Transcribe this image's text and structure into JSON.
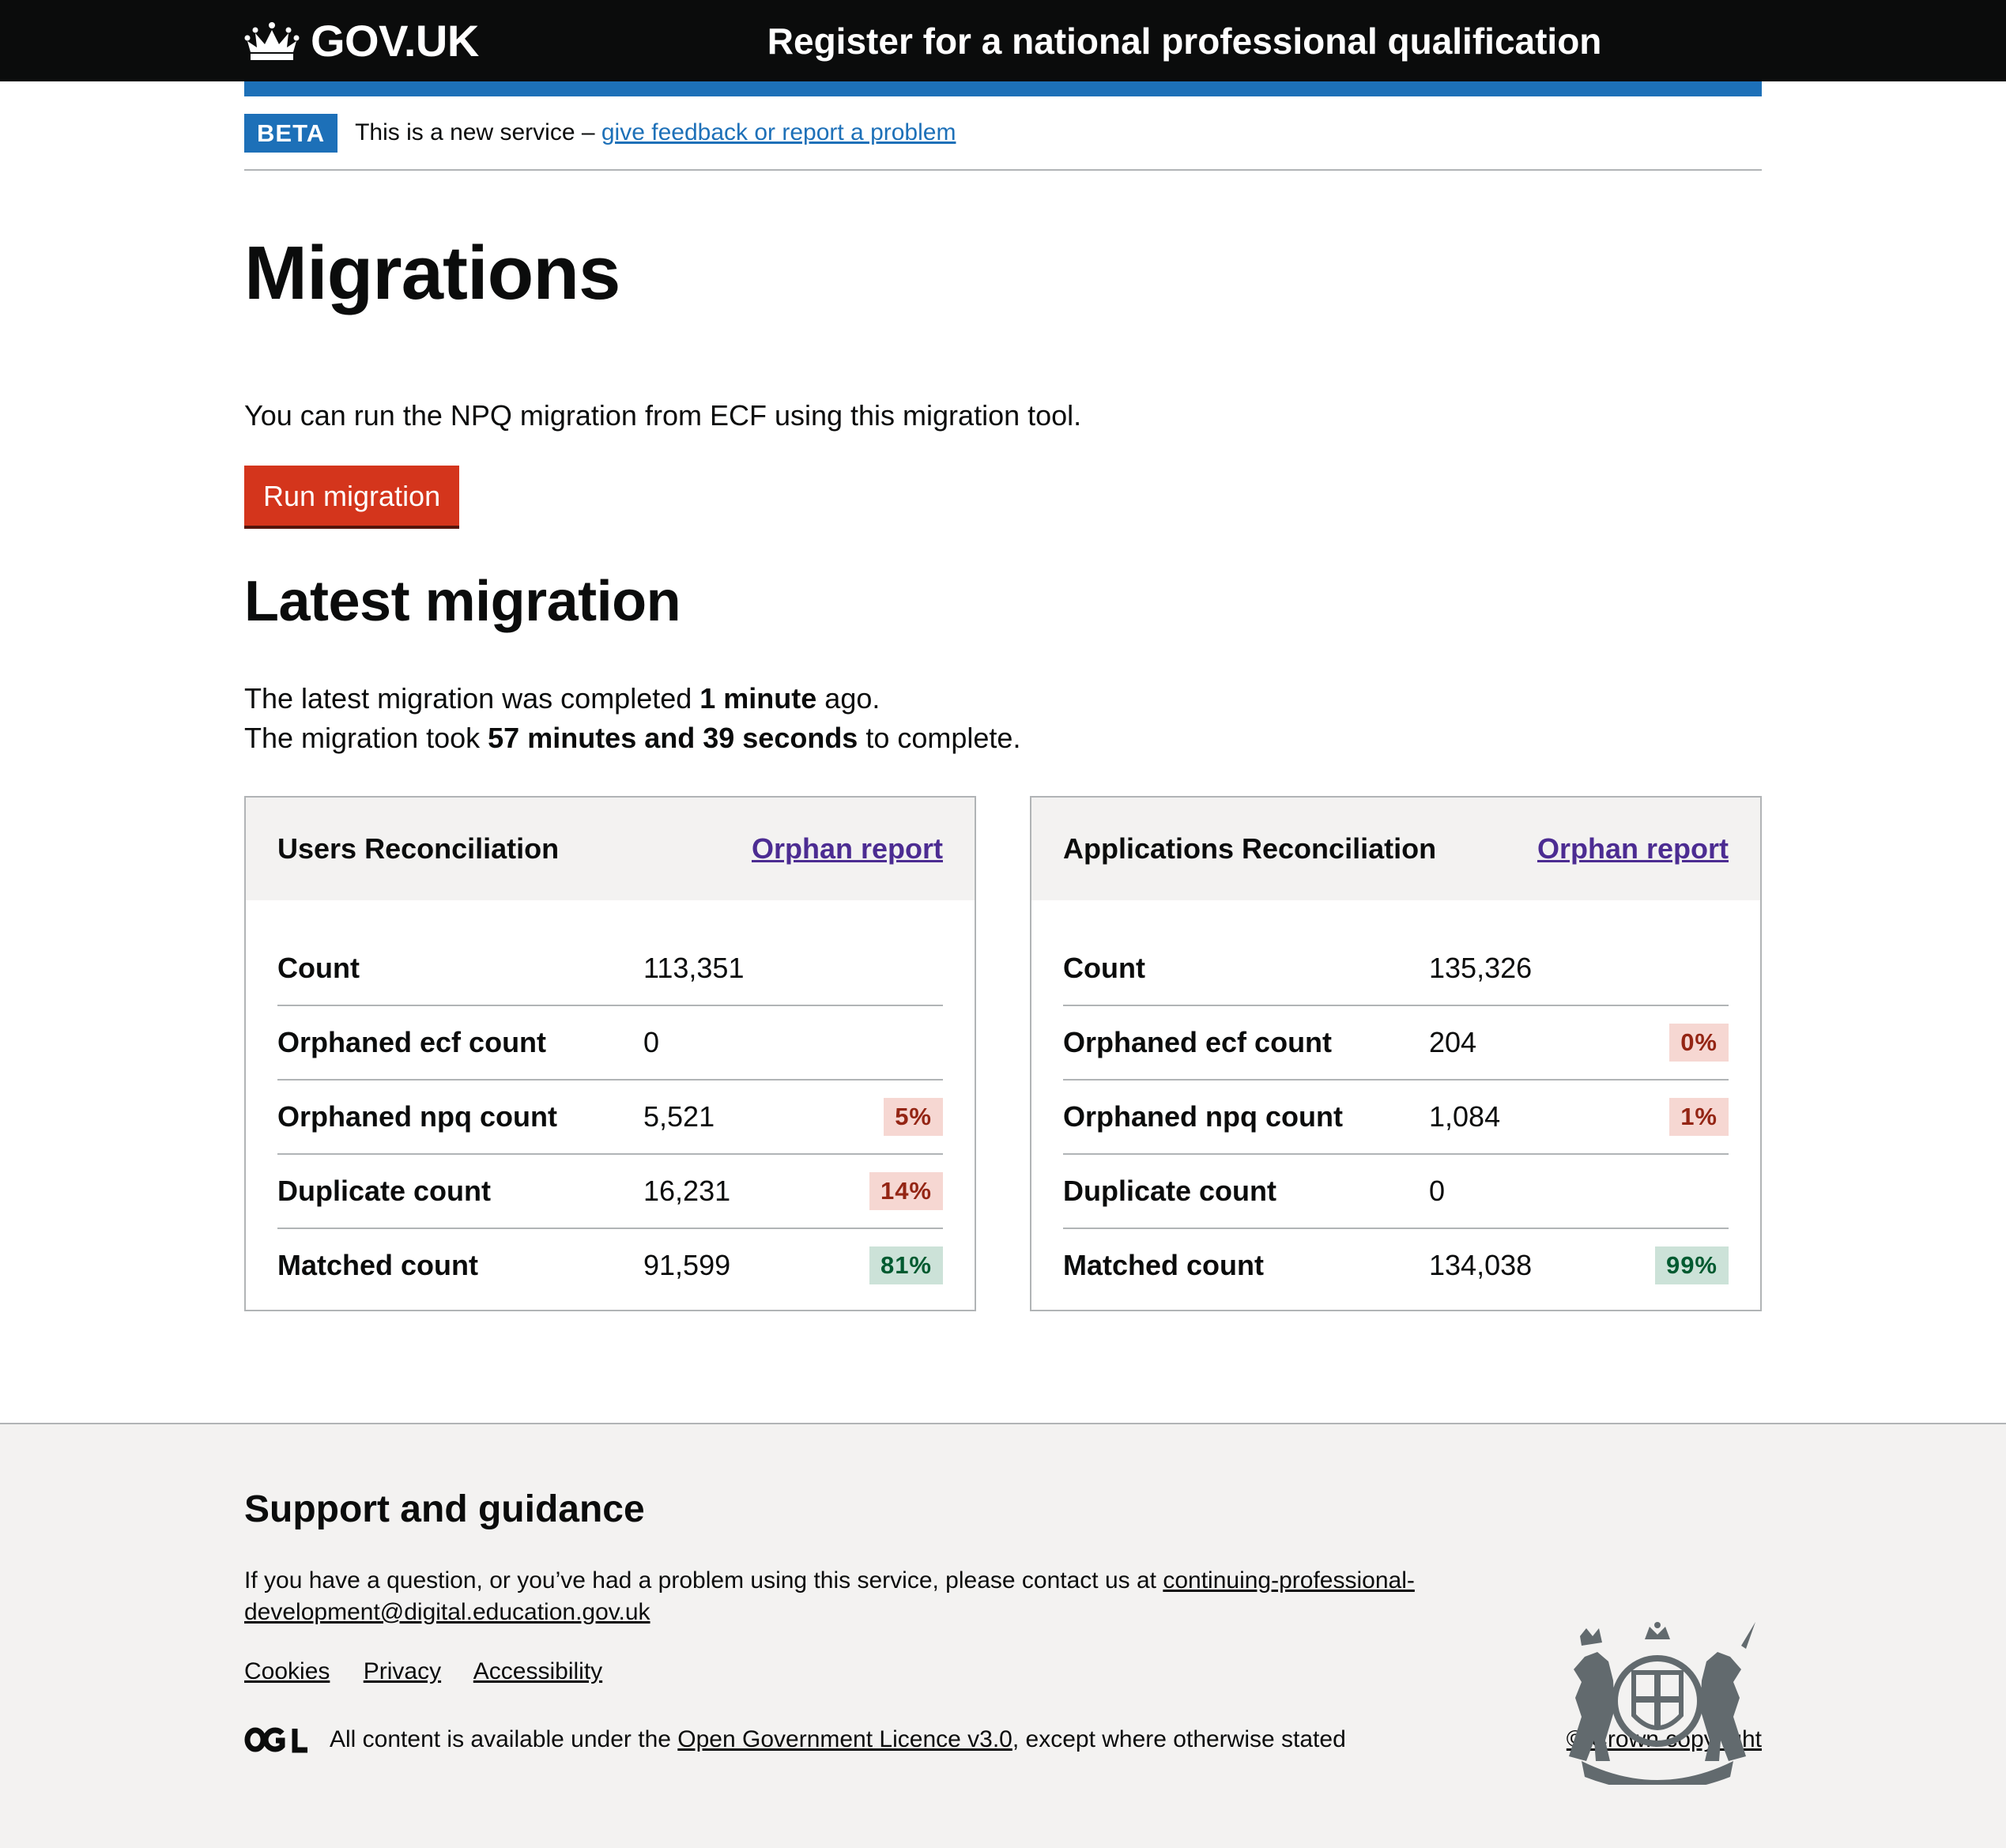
{
  "header": {
    "logo_text": "GOV.UK",
    "service_name": "Register for a national professional qualification"
  },
  "phase_banner": {
    "tag": "BETA",
    "text": "This is a new service – ",
    "link": "give feedback or report a problem"
  },
  "main": {
    "title": "Migrations",
    "intro": "You can run the NPQ migration from ECF using this migration tool.",
    "run_button": "Run migration",
    "latest_heading": "Latest migration",
    "summary": {
      "line1_pre": "The latest migration was completed ",
      "line1_bold": "1 minute",
      "line1_post": " ago.",
      "line2_pre": "The migration took ",
      "line2_bold": "57 minutes and 39 seconds",
      "line2_post": " to complete."
    },
    "cards": [
      {
        "title": "Users Reconciliation",
        "link": "Orphan report",
        "rows": [
          {
            "label": "Count",
            "value": "113,351",
            "tag": "",
            "tag_color": ""
          },
          {
            "label": "Orphaned ecf count",
            "value": "0",
            "tag": "",
            "tag_color": ""
          },
          {
            "label": "Orphaned npq count",
            "value": "5,521",
            "tag": "5%",
            "tag_color": "red"
          },
          {
            "label": "Duplicate count",
            "value": "16,231",
            "tag": "14%",
            "tag_color": "red"
          },
          {
            "label": "Matched count",
            "value": "91,599",
            "tag": "81%",
            "tag_color": "green"
          }
        ]
      },
      {
        "title": "Applications Reconciliation",
        "link": "Orphan report",
        "rows": [
          {
            "label": "Count",
            "value": "135,326",
            "tag": "",
            "tag_color": ""
          },
          {
            "label": "Orphaned ecf count",
            "value": "204",
            "tag": "0%",
            "tag_color": "red"
          },
          {
            "label": "Orphaned npq count",
            "value": "1,084",
            "tag": "1%",
            "tag_color": "red"
          },
          {
            "label": "Duplicate count",
            "value": "0",
            "tag": "",
            "tag_color": ""
          },
          {
            "label": "Matched count",
            "value": "134,038",
            "tag": "99%",
            "tag_color": "green"
          }
        ]
      }
    ]
  },
  "footer": {
    "heading": "Support and guidance",
    "text": "If you have a question, or you’ve had a problem using this service, please contact us at ",
    "email": "continuing-professional-development@digital.education.gov.uk",
    "links": [
      "Cookies",
      "Privacy",
      "Accessibility"
    ],
    "licence_pre": "All content is available under the ",
    "licence_link": "Open Government Licence v3.0",
    "licence_post": ", except where otherwise stated",
    "copyright": "© Crown copyright"
  },
  "colors": {
    "header_bg": "#0b0c0c",
    "brand_blue": "#1d70b8",
    "button_red": "#d4351c",
    "visited_link": "#4c2c92",
    "tag_red_bg": "#f6d7d2",
    "tag_green_bg": "#cce2d8"
  }
}
